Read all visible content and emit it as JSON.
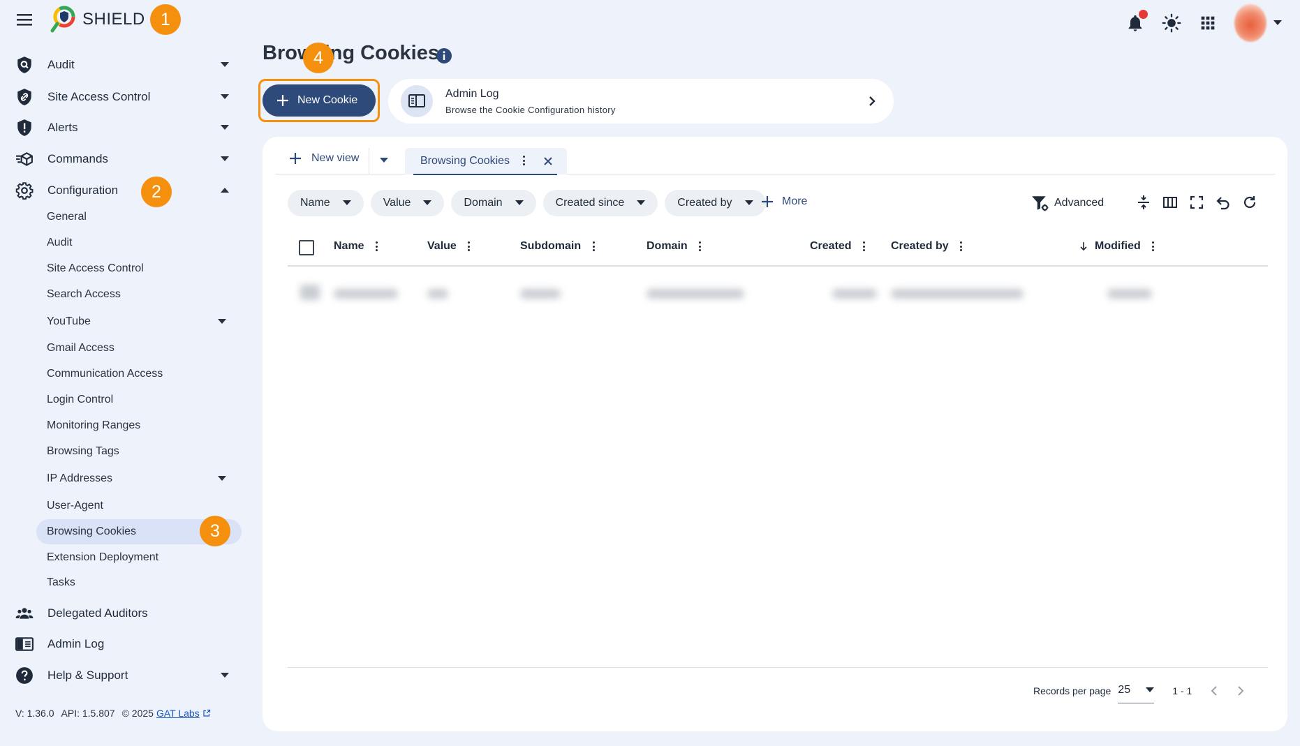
{
  "app": {
    "name": "SHIELD"
  },
  "badges": {
    "b1": "1",
    "b2": "2",
    "b3": "3",
    "b4": "4"
  },
  "colors": {
    "accent": "#f5900f",
    "primary": "#2e4a7a",
    "notification": "#e53935"
  },
  "sidebar": {
    "items": [
      {
        "label": "Audit",
        "icon": "audit-shield-icon"
      },
      {
        "label": "Site Access Control",
        "icon": "link-shield-icon"
      },
      {
        "label": "Alerts",
        "icon": "alert-shield-icon"
      },
      {
        "label": "Commands",
        "icon": "commands-icon"
      },
      {
        "label": "Configuration",
        "icon": "gear-icon"
      }
    ],
    "config_sub": [
      "General",
      "Audit",
      "Site Access Control",
      "Search Access",
      "YouTube",
      "Gmail Access",
      "Communication Access",
      "Login Control",
      "Monitoring Ranges",
      "Browsing Tags",
      "IP Addresses",
      "User-Agent",
      "Browsing Cookies",
      "Extension Deployment",
      "Tasks"
    ],
    "bottom": [
      {
        "label": "Delegated Auditors",
        "icon": "people-icon"
      },
      {
        "label": "Admin Log",
        "icon": "admin-log-icon"
      },
      {
        "label": "Help & Support",
        "icon": "help-icon"
      }
    ]
  },
  "footer": {
    "version": "V: 1.36.0",
    "api": "API: 1.5.807",
    "copyright": "© 2025",
    "link": "GAT Labs"
  },
  "page": {
    "title": "Browsing Cookies",
    "new_button": "New Cookie",
    "admin_log": {
      "title": "Admin Log",
      "subtitle": "Browse the Cookie Configuration history"
    }
  },
  "tabs": {
    "new_view": "New view",
    "active": "Browsing Cookies"
  },
  "filters": [
    "Name",
    "Value",
    "Domain",
    "Created since",
    "Created by"
  ],
  "more": "More",
  "advanced": "Advanced",
  "columns": [
    "Name",
    "Value",
    "Subdomain",
    "Domain",
    "Created",
    "Created by",
    "Modified"
  ],
  "pager": {
    "label": "Records per page",
    "per_page": "25",
    "range": "1 - 1"
  }
}
